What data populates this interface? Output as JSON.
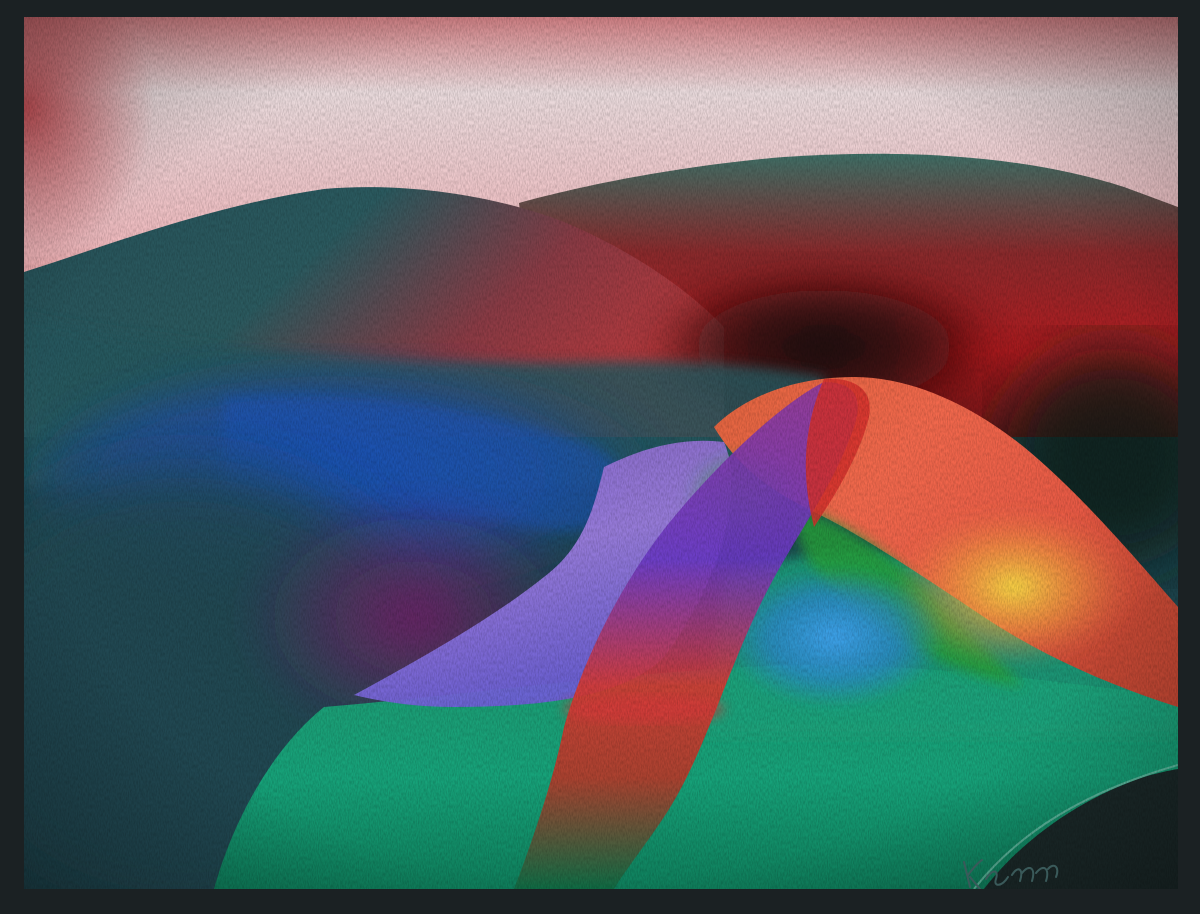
{
  "artwork": {
    "signature_text": "Kenn",
    "colors": {
      "frame": "#1b2123",
      "sky_top": "#e9cfd2",
      "sky_glow": "#f2a7a7",
      "hills_dark": "#1f4e57",
      "red_ridge": "#b11f22",
      "teal_field": "#15a57c",
      "blue_water": "#1d56b6",
      "violet_path": "#8f72d6",
      "orange_hill": "#f06a4f",
      "yellow_glow": "#f3d23b",
      "deep_shadow": "#0e1a18"
    }
  }
}
